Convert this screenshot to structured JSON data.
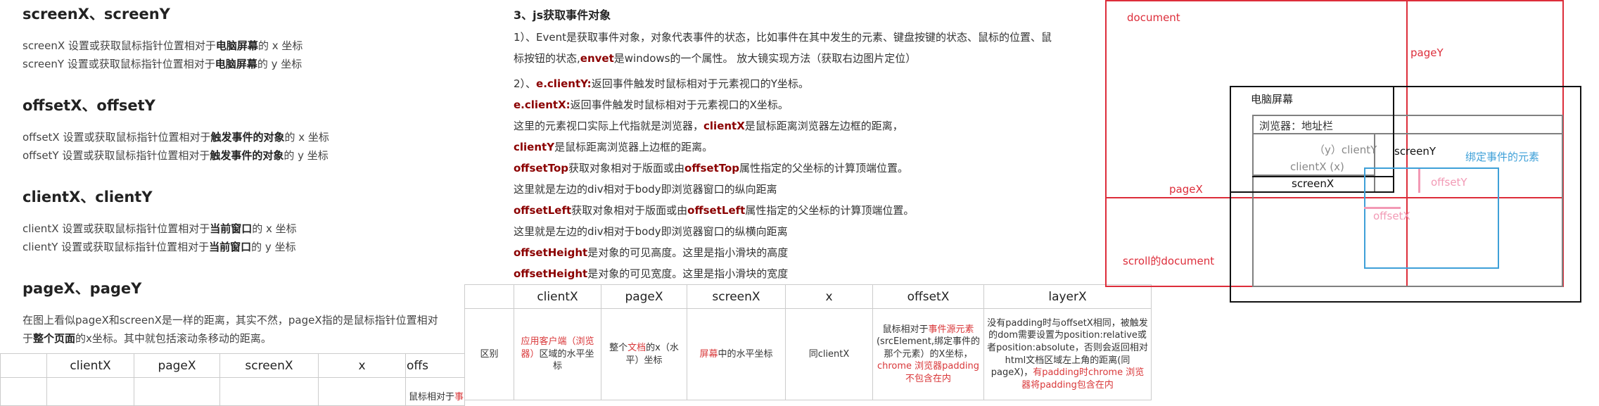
{
  "left": {
    "sections": [
      {
        "title": "screenX、screenY",
        "lines": [
          {
            "pre": "screenX 设置或获取鼠标指针位置相对于",
            "bold": "电脑屏幕",
            "post": "的 x 坐标"
          },
          {
            "pre": "screenY 设置或获取鼠标指针位置相对于",
            "bold": "电脑屏幕",
            "post": "的 y 坐标"
          }
        ]
      },
      {
        "title": "offsetX、offsetY",
        "lines": [
          {
            "pre": "offsetX 设置或获取鼠标指针位置相对于",
            "bold": "触发事件的对象",
            "post": "的 x 坐标"
          },
          {
            "pre": "offsetY 设置或获取鼠标指针位置相对于",
            "bold": "触发事件的对象",
            "post": "的 y 坐标"
          }
        ]
      },
      {
        "title": "clientX、clientY",
        "lines": [
          {
            "pre": "clientX 设置或获取鼠标指针位置相对于",
            "bold": "当前窗口",
            "post": "的 x 坐标"
          },
          {
            "pre": "clientY 设置或获取鼠标指针位置相对于",
            "bold": "当前窗口",
            "post": "的 y 坐标"
          }
        ]
      },
      {
        "title": "pageX、pageY",
        "lines": [
          {
            "pre": "在图上看似pageX和screenX是一样的距离，其实不然，pageX指的是鼠标指针位置相对",
            "bold": "",
            "post": ""
          },
          {
            "pre": "于",
            "bold": "整个页面",
            "post": "的x坐标。其中就包括滚动条移动的距离。"
          }
        ]
      }
    ],
    "table_headers": [
      "clientX",
      "pageX",
      "screenX",
      "x",
      "offs"
    ],
    "table_fragment": "鼠标相对于",
    "table_fragment_red": "事"
  },
  "middle": {
    "heading": "3、js获取事件对象",
    "para1_l1": "1）、Event是获取事件对象，对象代表事件的状态，比如事件在其中发生的元素、键盘按键的状态、鼠标的位置、鼠",
    "para1_l2_pre": "标按钮的状态,",
    "para1_l2_kw": "envet",
    "para1_l2_post": "是windows的一个属性。 放大镜实现方法（获取右边图片定位）",
    "lines": [
      {
        "pre": "2）、",
        "kw": "e.clientY:",
        "post": "返回事件触发时鼠标相对于元素视口的Y坐标。"
      },
      {
        "pre": "",
        "kw": "e.clientX:",
        "post": "返回事件触发时鼠标相对于元素视口的X坐标。"
      },
      {
        "pre": "这里的元素视口实际上代指就是浏览器，",
        "kw": "clientX",
        "post": "是鼠标距离浏览器左边框的距离，"
      },
      {
        "pre": "",
        "kw": "clientY",
        "post": "是鼠标距离浏览器上边框的距离。"
      },
      {
        "pre": "",
        "kw": "offsetTop",
        "post": "获取对象相对于版面或由",
        "kw2": "offsetTop",
        "post2": "属性指定的父坐标的计算顶端位置。"
      },
      {
        "pre": "这里就是左边的div相对于body即浏览器窗口的纵向距离",
        "kw": "",
        "post": ""
      },
      {
        "pre": "",
        "kw": "offsetLeft",
        "post": "获取对象相对于版面或由",
        "kw2": "offsetLeft",
        "post2": "属性指定的父坐标的计算顶端位置。"
      },
      {
        "pre": "这里就是左边的div相对于body即浏览器窗口的纵横向距离",
        "kw": "",
        "post": ""
      },
      {
        "pre": "",
        "kw": "offsetHeight",
        "post": "是对象的可见高度。这里是指小滑块的高度"
      },
      {
        "pre": "",
        "kw": "offsetHeight",
        "post": "是对象的可见宽度。这里是指小滑块的宽度"
      }
    ],
    "table": {
      "headers": [
        "",
        "clientX",
        "pageX",
        "screenX",
        "x",
        "offsetX",
        "layerX"
      ],
      "row_label": "区别",
      "c_client_red": "应用客户端（浏览器）",
      "c_client_post": "区域的水平坐标",
      "c_page_pre": "整个",
      "c_page_red": "文档",
      "c_page_post": "的x（水平）坐标",
      "c_screen_red": "屏幕",
      "c_screen_post": "中的水平坐标",
      "c_x": "同clientX",
      "c_offset_pre": "鼠标相对于",
      "c_offset_red": "事件源元素",
      "c_offset_mid": "(srcElement,绑定事件的那个元素）的X坐标，",
      "c_offset_red2": "chrome 浏览器padding不包含在内",
      "c_layer_pre": "没有padding时与offsetX相同，被触发的dom需要设置为position:relative或者position:absolute，否则会返回相对html文档区域左上角的距离(同pageX)，",
      "c_layer_red": "有padding时chrome 浏览器将padding包含在内"
    }
  },
  "diagram": {
    "document_label": "document",
    "pageY_label": "pageY",
    "screen_label": "电脑屏幕",
    "browser_label": "浏览器：地址栏",
    "clientY_label": "（y）clientY",
    "clientX_label": "clientX (x)",
    "screenY_label": "screenY",
    "screenX_label": "screenX",
    "bound_label": "绑定事件的元素",
    "offsetY_label": "offsetY",
    "offsetX_label": "offsetX",
    "pageX_label": "pageX",
    "scroll_label": "scroll的document",
    "colors": {
      "red": "#dd2d3a",
      "black": "#111111",
      "gray": "#808080",
      "blue": "#3ea0d8",
      "pink": "#f29ab5"
    }
  }
}
